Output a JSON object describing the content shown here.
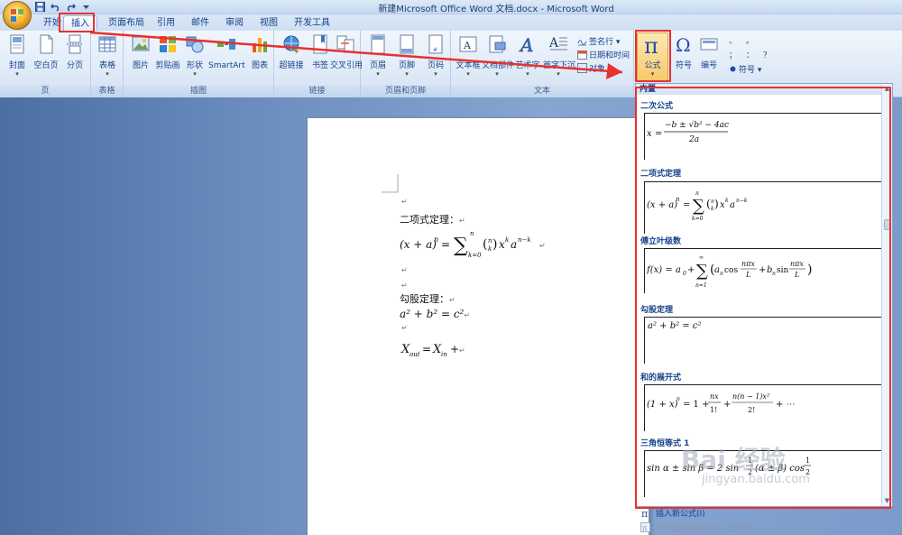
{
  "window": {
    "title": "新建Microsoft Office Word 文档.docx - Microsoft Word"
  },
  "qat": {
    "icons": [
      "save-icon",
      "undo-icon",
      "redo-icon",
      "customize-qat-icon"
    ]
  },
  "tabs": [
    {
      "label": "开始"
    },
    {
      "label": "插入"
    },
    {
      "label": "页面布局"
    },
    {
      "label": "引用"
    },
    {
      "label": "邮件"
    },
    {
      "label": "审阅"
    },
    {
      "label": "视图"
    },
    {
      "label": "开发工具"
    }
  ],
  "ribbon": {
    "groups": {
      "pages": "页",
      "tables": "表格",
      "illustrations": "插图",
      "links": "链接",
      "header_footer": "页眉和页脚",
      "text": "文本"
    },
    "buttons": {
      "cover": "封面",
      "blank": "空白页",
      "pagebreak": "分页",
      "table": "表格",
      "picture": "图片",
      "clipart": "剪贴画",
      "shapes": "形状",
      "smartart": "SmartArt",
      "chart": "图表",
      "hyperlink": "超链接",
      "bookmark": "书签",
      "crossref": "交叉引用",
      "header": "页眉",
      "footer": "页脚",
      "pagenum": "页码",
      "textbox": "文本框",
      "quickparts": "文档部件",
      "wordart": "艺术字",
      "dropcap": "首字下沉",
      "signature": "签名行 ▾",
      "datetime": "日期和时间",
      "object": "对象 ▾",
      "equation": "公式",
      "symbol": "符号",
      "number": "编号",
      "symbol_small": "符号 ▾"
    },
    "symbol_chars": [
      "、",
      "。",
      "；",
      "：",
      "？"
    ]
  },
  "document": {
    "lines": {
      "binomial_label": "二项式定理：",
      "pythagoras_label": "勾股定理：",
      "pythagoras_eq": "a² + b² = c²"
    }
  },
  "gallery": {
    "header": "内置",
    "items": [
      {
        "title": "二次公式"
      },
      {
        "title": "二项式定理"
      },
      {
        "title": "傅立叶级数"
      },
      {
        "title": "勾股定理"
      },
      {
        "title": "和的展开式"
      },
      {
        "title": "三角恒等式 1"
      }
    ],
    "commands": {
      "insert_new": "插入新公式(I)",
      "save_selection": "将所选内容保存到公式库(S)..."
    }
  },
  "watermark": {
    "text": "Bai 经验",
    "url": "jingyan.baidu.com"
  },
  "colors": {
    "highlight": "#e8302e",
    "ribbon_text": "#15428b"
  }
}
